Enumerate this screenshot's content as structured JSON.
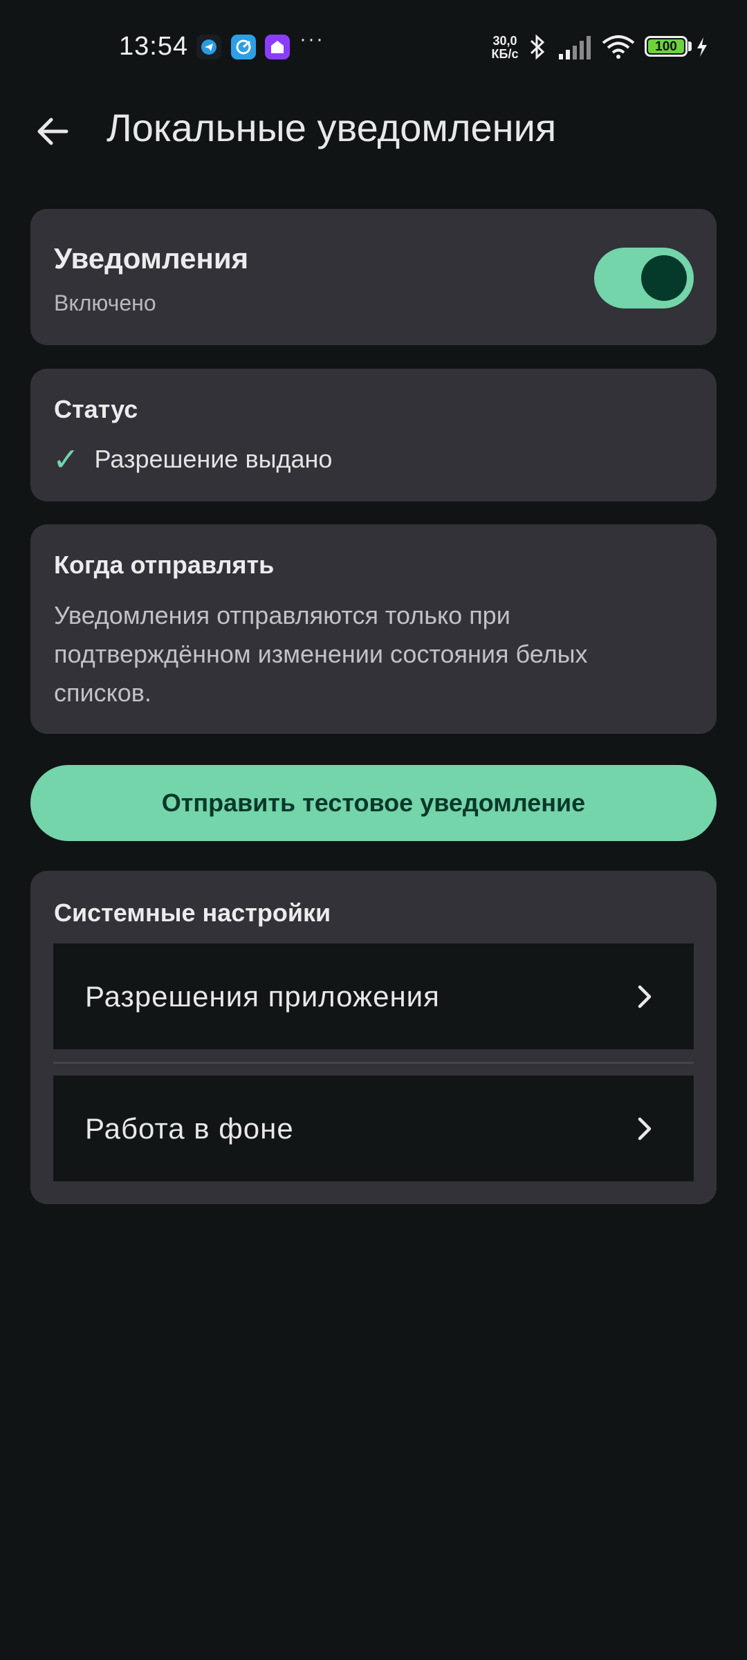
{
  "status_bar": {
    "time": "13:54",
    "app_icons": [
      "telegram-icon",
      "browser-icon",
      "home-app-icon"
    ],
    "overflow": "···",
    "network_speed_value": "30,0",
    "network_speed_unit": "КБ/с",
    "battery": "100"
  },
  "header": {
    "title": "Локальные уведомления"
  },
  "notifications_card": {
    "title": "Уведомления",
    "subtitle": "Включено",
    "toggle_on": true
  },
  "status_card": {
    "heading": "Статус",
    "check": "✓",
    "text": "Разрешение выдано"
  },
  "when_card": {
    "heading": "Когда отправлять",
    "text": "Уведомления отправляются только при подтверждённом изменении состояния белых списков."
  },
  "test_button": {
    "label": "Отправить тестовое уведомление"
  },
  "system_settings": {
    "heading": "Системные настройки",
    "items": [
      {
        "label": "Разрешения приложения"
      },
      {
        "label": "Работа в фоне"
      }
    ]
  },
  "colors": {
    "background": "#101415",
    "card": "#333238",
    "accent": "#74d4aa",
    "accent_dark": "#053a2a"
  }
}
